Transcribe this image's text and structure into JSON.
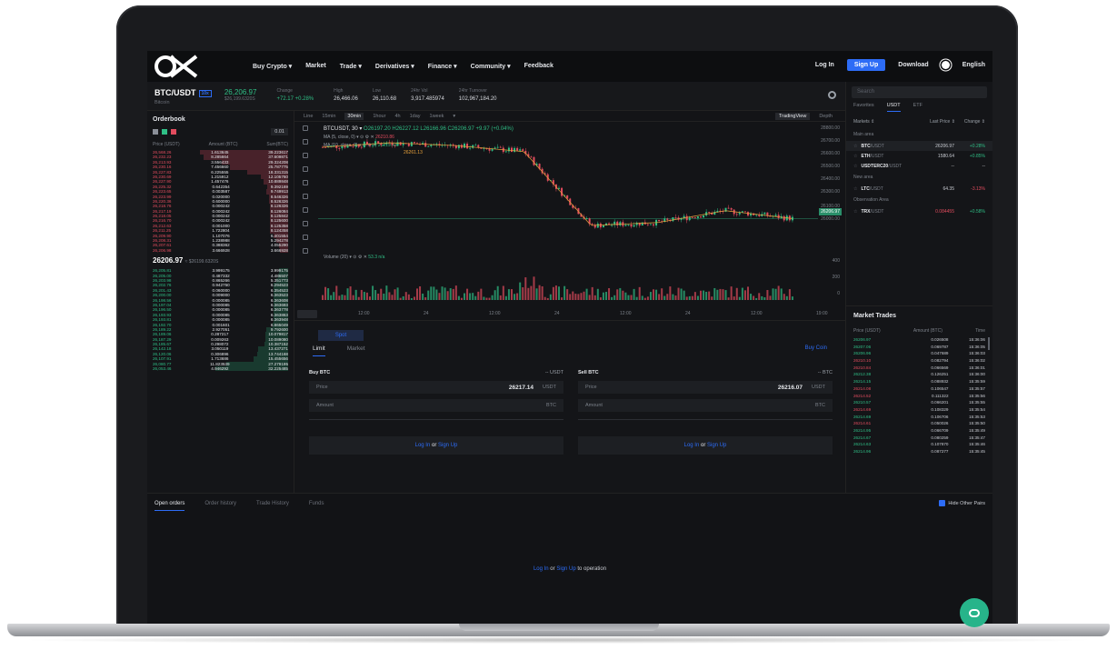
{
  "nav": {
    "links": [
      "Buy Crypto ▾",
      "Market",
      "Trade ▾",
      "Derivatives ▾",
      "Finance ▾",
      "Community ▾",
      "Feedback"
    ],
    "login": "Log In",
    "signup": "Sign Up",
    "download": "Download",
    "language": "English"
  },
  "ticker": {
    "pair": "BTC/USDT",
    "badge": "10x",
    "sub": "Bitcoin",
    "price": "26,206.97",
    "price_usd": "$26,199.6320S",
    "change_label": "Change",
    "change_value": "+72.17 +0.28%",
    "high_label": "High",
    "high_value": "26,466.06",
    "low_label": "Low",
    "low_value": "26,110.68",
    "vol_label": "24hr Vol",
    "vol_value": "3,917.485974",
    "turnover_label": "24hr Turnover",
    "turnover_value": "102,967,184.20"
  },
  "orderbook": {
    "title": "Orderbook",
    "decimal": "0.01",
    "headers": [
      "Price (USDT)",
      "Amount (BTC)",
      "Sum(BTC)"
    ],
    "asks": [
      [
        "26,568.26",
        "1.613645",
        "39.223617"
      ],
      [
        "26,232.23",
        "8.285664",
        "37.609871"
      ],
      [
        "26,213.93",
        "3.556433",
        "29.324208"
      ],
      [
        "26,230.16",
        "7.456660",
        "25.787775"
      ],
      [
        "26,227.83",
        "6.225555",
        "18.331315"
      ],
      [
        "26,230.69",
        "1.215912",
        "12.105760"
      ],
      [
        "26,227.90",
        "1.457476",
        "10.889848"
      ],
      [
        "26,225.32",
        "0.642354",
        "9.392169"
      ],
      [
        "26,223.65",
        "0.003587",
        "9.749913"
      ],
      [
        "26,223.99",
        "0.020000",
        "8.546326"
      ],
      [
        "26,220.36",
        "0.600000",
        "8.526326"
      ],
      [
        "26,218.76",
        "0.000242",
        "8.126326"
      ],
      [
        "26,217.19",
        "0.000242",
        "8.126084"
      ],
      [
        "26,218.05",
        "0.000242",
        "8.125842"
      ],
      [
        "26,216.70",
        "0.000242",
        "8.125600"
      ],
      [
        "26,212.63",
        "0.001000",
        "8.125358"
      ],
      [
        "26,211.25",
        "1.722804",
        "8.124358"
      ],
      [
        "26,209.90",
        "1.107076",
        "6.401554"
      ],
      [
        "26,208.31",
        "1.238988",
        "5.294278"
      ],
      [
        "26,207.61",
        "0.388362",
        "4.055290"
      ],
      [
        "26,206.98",
        "3.666928",
        "3.666928"
      ]
    ],
    "mid_price": "26206.97",
    "mid_usd": "≈ $26199.6320S",
    "bids": [
      [
        "26,205.81",
        "3.999175",
        "3.999175"
      ],
      [
        "26,205.00",
        "0.487332",
        "4.486507"
      ],
      [
        "26,203.98",
        "0.865266",
        "5.351773"
      ],
      [
        "26,202.76",
        "0.942750",
        "6.294523"
      ],
      [
        "26,201.43",
        "0.060000",
        "6.354523"
      ],
      [
        "26,200.00",
        "0.009000",
        "6.363523"
      ],
      [
        "26,198.56",
        "0.000085",
        "6.363608"
      ],
      [
        "26,197.04",
        "0.000085",
        "6.363693"
      ],
      [
        "26,196.50",
        "0.000085",
        "6.363778"
      ],
      [
        "26,193.93",
        "0.000085",
        "6.363863"
      ],
      [
        "26,193.81",
        "0.000085",
        "6.363948"
      ],
      [
        "26,192.70",
        "0.001601",
        "6.865049"
      ],
      [
        "26,189.22",
        "2.927051",
        "9.792600"
      ],
      [
        "26,189.06",
        "0.287217",
        "10.079817"
      ],
      [
        "26,187.29",
        "0.009263",
        "10.089080"
      ],
      [
        "26,185.67",
        "0.298072",
        "10.387152"
      ],
      [
        "26,142.18",
        "3.050119",
        "13.437271"
      ],
      [
        "26,120.06",
        "0.306896",
        "13.744168"
      ],
      [
        "26,107.91",
        "1.713686",
        "15.455656"
      ],
      [
        "26,080.77",
        "11.823539",
        "27.279195"
      ],
      [
        "26,053.46",
        "4.946292",
        "32.225485"
      ]
    ]
  },
  "chart": {
    "toolbar": [
      "Line",
      "15min",
      "30min",
      "1hour",
      "4h",
      "1day",
      "1week",
      "▾"
    ],
    "active_interval": "30min",
    "tradingview": "TradingView",
    "depth": "Depth",
    "symbol_line": "BTCUSDT, 30 ▾",
    "ohlc": "O26197.20  H26227.12  L26166.96  C26206.97  +9.97 (+0.04%)",
    "ma5": "MA (5, close, 0) ▾  ⊙ ⚙ ✕",
    "ma5_value": "26210.86",
    "ma10": "MA (10, close, 0) ▾  ⊙ ⚙ ✕",
    "ma10_value": "26219.43",
    "ma30_value": "26261.13",
    "volume_label": "Volume (20) ▾  ⊙ ⚙ ✕",
    "volume_value": "53.3  n/a",
    "y_ticks": [
      "28800.00",
      "26700.00",
      "26600.00",
      "26500.00",
      "26400.00",
      "26300.00",
      "26100.00",
      "26000.00",
      "400",
      "200",
      "0"
    ],
    "last_price_tag": "26206.97",
    "x_ticks": [
      "12:00",
      "24",
      "12:00",
      "24",
      "12:00",
      "24",
      "12:00",
      "19:00"
    ]
  },
  "chart_data": {
    "type": "line",
    "x": [
      "12:00",
      "24",
      "12:00",
      "24",
      "12:00",
      "24",
      "12:00",
      "19:00"
    ],
    "series": [
      {
        "name": "BTCUSDT",
        "values": [
          26690,
          26720,
          26700,
          26660,
          26160,
          26180,
          26260,
          26206.97
        ]
      }
    ],
    "ylim": [
      26000,
      26800
    ]
  },
  "form": {
    "spot": "Spot",
    "tabs": [
      "Limit",
      "Market"
    ],
    "buy_coin": "Buy Coin",
    "buy_title": "Buy BTC",
    "sell_title": "Sell BTC",
    "buy_balance": "-- USDT",
    "sell_balance": "-- BTC",
    "price_label": "Price",
    "amount_label": "Amount",
    "buy_price": "26217.14",
    "sell_price": "26216.07",
    "usdt": "USDT",
    "btc": "BTC",
    "login": "Log In",
    "or": "or",
    "signup": "Sign Up"
  },
  "markets": {
    "search_placeholder": "Search",
    "tabs": [
      "Favorites",
      "USDT",
      "ETF"
    ],
    "headers": [
      "Markets ⇕",
      "Last Price ⇕",
      "Change ⇕"
    ],
    "main_area": "Main area",
    "new_area": "New area",
    "obs_area": "Observation Area",
    "main": [
      {
        "name": "BTC",
        "quote": "/USDT",
        "price": "26206.97",
        "change": "+0.28%",
        "dir": "up"
      },
      {
        "name": "ETH",
        "quote": "/USDT",
        "price": "1580.64",
        "change": "+0.85%",
        "dir": "up"
      },
      {
        "name": "USDTERC20",
        "quote": "/USDT",
        "price": "--",
        "change": "--",
        "dir": "none"
      }
    ],
    "new": [
      {
        "name": "LTC",
        "quote": "/USDT",
        "price": "64.35",
        "change": "-3.13%",
        "dir": "down"
      }
    ],
    "obs": [
      {
        "name": "TRX",
        "quote": "/USDT",
        "price": "0.084455",
        "change": "+0.58%",
        "dir": "up"
      }
    ]
  },
  "trades": {
    "title": "Market Trades",
    "headers": [
      "Price (USDT)",
      "Amount (BTC)",
      "Time"
    ],
    "rows": [
      [
        "26206.97",
        "0.026508",
        "15:36:06",
        "up"
      ],
      [
        "26207.06",
        "0.069787",
        "15:36:05",
        "up"
      ],
      [
        "26206.96",
        "0.047689",
        "15:36:03",
        "up"
      ],
      [
        "26210.10",
        "0.082794",
        "15:36:02",
        "down"
      ],
      [
        "26210.84",
        "0.066569",
        "15:36:01",
        "down"
      ],
      [
        "26212.38",
        "0.126251",
        "15:36:00",
        "up"
      ],
      [
        "26214.15",
        "0.088932",
        "15:35:59",
        "up"
      ],
      [
        "26214.08",
        "0.106547",
        "15:35:57",
        "down"
      ],
      [
        "26214.52",
        "0.111322",
        "15:35:56",
        "down"
      ],
      [
        "26210.57",
        "0.066201",
        "15:35:55",
        "up"
      ],
      [
        "26214.69",
        "0.108329",
        "15:35:54",
        "down"
      ],
      [
        "26214.69",
        "0.106706",
        "15:35:53",
        "up"
      ],
      [
        "26214.61",
        "0.050026",
        "15:35:50",
        "down"
      ],
      [
        "26214.95",
        "0.066709",
        "15:35:49",
        "up"
      ],
      [
        "26214.67",
        "0.080259",
        "15:35:47",
        "up"
      ],
      [
        "26214.63",
        "0.107870",
        "15:35:46",
        "up"
      ],
      [
        "26214.96",
        "0.087277",
        "15:35:45",
        "up"
      ]
    ]
  },
  "bottom": {
    "tabs": [
      "Open orders",
      "Order history",
      "Trade History",
      "Funds"
    ],
    "hide_pairs": "Hide Other Pairs",
    "login": "Log In",
    "or": "or",
    "signup": "Sign Up",
    "tail": "to operation"
  },
  "colors": {
    "accent": "#2d6cf6",
    "up": "#2fbf86",
    "down": "#e24c5e",
    "bg": "#131417"
  }
}
